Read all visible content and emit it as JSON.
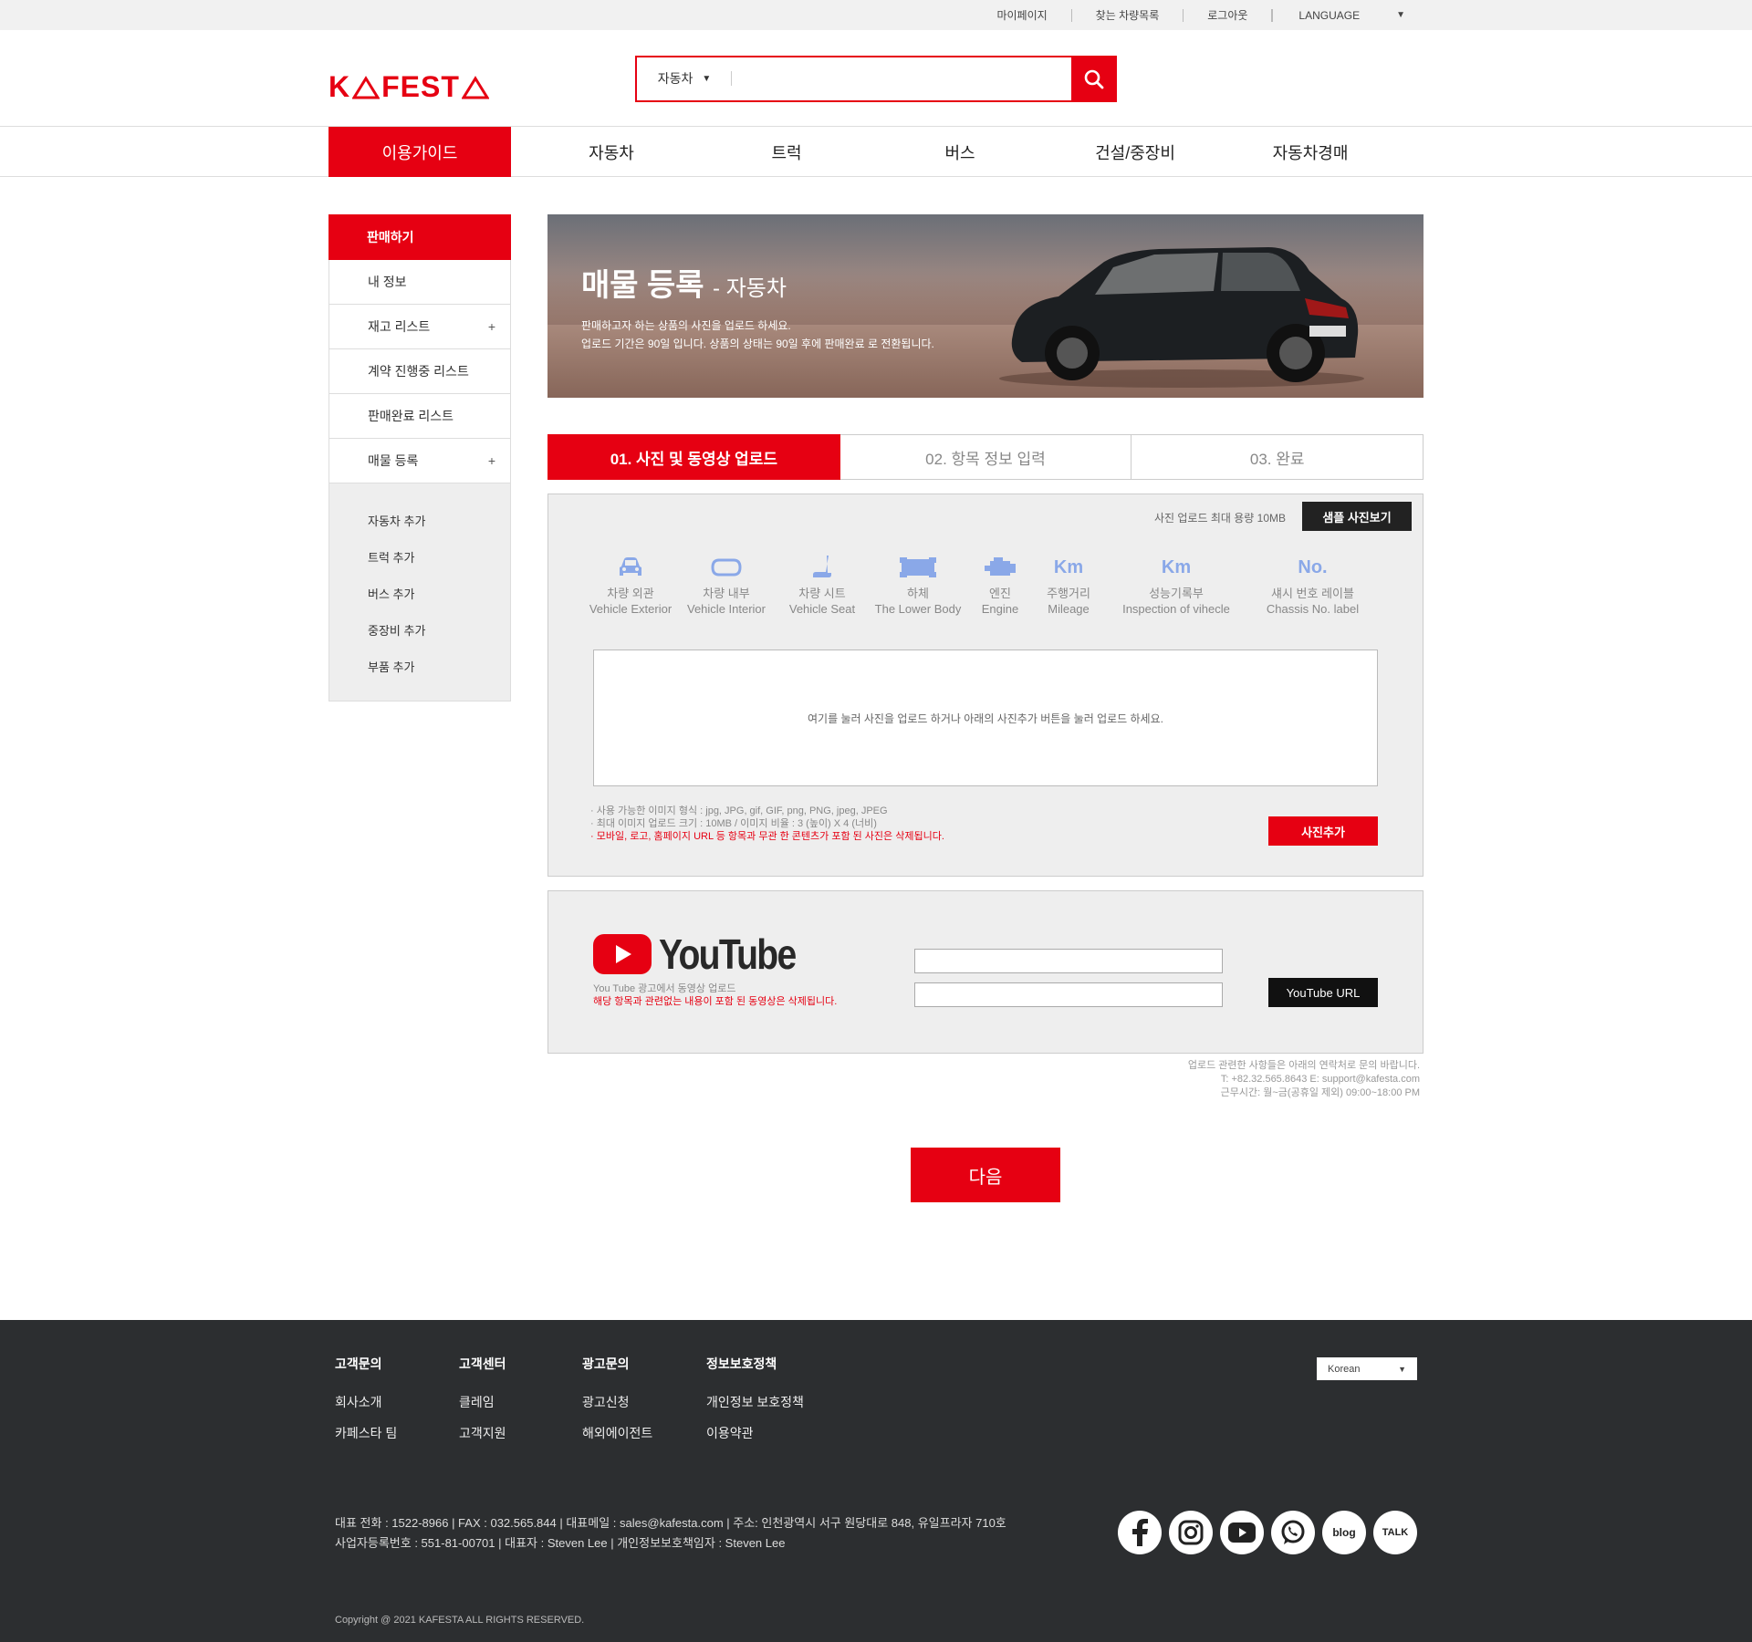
{
  "topbar": {
    "links": [
      "마이페이지",
      "찾는 차량목록",
      "로그아웃"
    ],
    "language_label": "LANGUAGE"
  },
  "header": {
    "logo_text_a": "K",
    "logo_text_b": "FEST",
    "search_category": "자동차",
    "search_value": ""
  },
  "nav": {
    "items": [
      "이용가이드",
      "자동차",
      "트럭",
      "버스",
      "건설/중장비",
      "자동차경매"
    ]
  },
  "sidebar": {
    "head": "판매하기",
    "items": [
      {
        "label": "내 정보",
        "expand": ""
      },
      {
        "label": "재고 리스트",
        "expand": "+"
      },
      {
        "label": "계약 진행중 리스트",
        "expand": ""
      },
      {
        "label": "판매완료 리스트",
        "expand": ""
      },
      {
        "label": "매물 등록",
        "expand": "+"
      }
    ],
    "sub_items": [
      "자동차 추가",
      "트럭 추가",
      "버스 추가",
      "중장비 추가",
      "부품 추가"
    ]
  },
  "banner": {
    "title": "매물 등록",
    "subtitle": "- 자동차",
    "line1": "판매하고자 하는 상품의 사진을 업로드 하세요.",
    "line2": "업로드 기간은 90일 입니다. 상품의 상태는 90일 후에 판매완료 로 전환됩니다."
  },
  "steps": [
    "01. 사진 및 동영상 업로드",
    "02. 항목 정보 입력",
    "03. 완료"
  ],
  "upload": {
    "max_size": "사진 업로드 최대 용량 10MB",
    "sample_button": "샘플 사진보기",
    "categories": [
      {
        "ko": "차량 외관",
        "en": "Vehicle Exterior",
        "icon": "car-exterior-icon"
      },
      {
        "ko": "차량 내부",
        "en": "Vehicle Interior",
        "icon": "car-interior-icon"
      },
      {
        "ko": "차량 시트",
        "en": "Vehicle Seat",
        "icon": "seat-icon"
      },
      {
        "ko": "하체",
        "en": "The Lower Body",
        "icon": "chassis-icon"
      },
      {
        "ko": "엔진",
        "en": "Engine",
        "icon": "engine-icon"
      },
      {
        "ko": "주행거리",
        "en": "Mileage",
        "icon": "Km"
      },
      {
        "ko": "성능기록부",
        "en": "Inspection of vihecle",
        "icon": "Km"
      },
      {
        "ko": "섀시 번호 레이블",
        "en": "Chassis No. label",
        "icon": "No."
      }
    ],
    "dropzone_text": "여기를 눌러 사진을 업로드 하거나 아래의 사진추가 버튼을 눌러 업로드 하세요.",
    "note1": "·  사용 가능한 이미지 형식 :   jpg, JPG, gif, GIF, png, PNG, jpeg, JPEG",
    "note2": "·  최대 이미지 업로드 크기 : 10MB / 이미지 비율 : 3 (높이) X 4 (너비)",
    "note3": "·  모바일, 로고, 홈페이지 URL 등 항목과 무관 한 콘텐츠가 포함 된 사진은 삭제됩니다.",
    "add_button": "사진추가"
  },
  "youtube": {
    "wordmark": "YouTube",
    "info1": "You Tube 광고에서 동영상 업로드",
    "info2": "해당 항목과 관련없는 내용이 포함 된 동영상은 삭제됩니다.",
    "url_button": "YouTube URL"
  },
  "contact": {
    "line1": "업로드 관련한 사항들은 아래의 연락처로 문의 바랍니다.",
    "line2": "T: +82.32.565.8643 E: support@kafesta.com",
    "line3": "근무시간: 월~금(공휴일 제외) 09:00~18:00 PM"
  },
  "next_button": "다음",
  "footer": {
    "columns": [
      {
        "head": "고객문의",
        "links": [
          "회사소개",
          "카페스타 팀"
        ]
      },
      {
        "head": "고객센터",
        "links": [
          "클레임",
          "고객지원"
        ]
      },
      {
        "head": "광고문의",
        "links": [
          "광고신청",
          "해외에이전트"
        ]
      },
      {
        "head": "정보보호정책",
        "links": [
          "개인정보 보호정책",
          "이용약관"
        ]
      }
    ],
    "language_select": "Korean",
    "info1": "대표 전화 : 1522-8966 | FAX : 032.565.844 | 대표메일 : sales@kafesta.com | 주소: 인천광역시 서구 원당대로 848, 유일프라자 710호",
    "info2": "사업자등록번호 : 551-81-00701 | 대표자 : Steven Lee | 개인정보보호책임자 : Steven Lee",
    "copyright": "Copyright @ 2021 KAFESTA ALL RIGHTS RESERVED.",
    "social": [
      "facebook-icon",
      "instagram-icon",
      "youtube-icon",
      "whatsapp-icon",
      "blog",
      "TALK"
    ]
  },
  "colors": {
    "accent": "#e60012",
    "footer_bg": "#2c2e30",
    "icon_blue": "#8aa8e8"
  }
}
